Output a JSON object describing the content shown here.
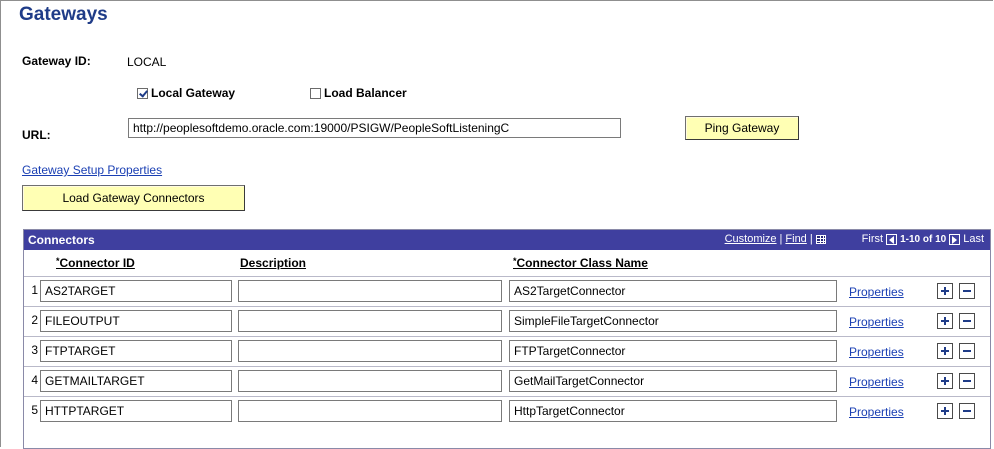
{
  "page": {
    "title": "Gateways"
  },
  "gateway": {
    "id_label": "Gateway ID:",
    "id_value": "LOCAL",
    "local_gateway_label": "Local Gateway",
    "local_gateway_checked": true,
    "load_balancer_label": "Load Balancer",
    "load_balancer_checked": false,
    "url_label": "URL:",
    "url_value": "http://peoplesoftdemo.oracle.com:19000/PSIGW/PeopleSoftListeningC",
    "ping_button": "Ping Gateway",
    "setup_link": "Gateway Setup Properties",
    "load_connectors_button": "Load Gateway Connectors"
  },
  "grid": {
    "title": "Connectors",
    "customize": "Customize",
    "find": "Find",
    "first": "First",
    "range": "1-10 of 10",
    "last": "Last",
    "columns": {
      "connector_id": "Connector ID",
      "description": "Description",
      "class_name": "Connector Class Name"
    },
    "properties_label": "Properties",
    "rows": [
      {
        "num": "1",
        "connector_id": "AS2TARGET",
        "description": "",
        "class_name": "AS2TargetConnector"
      },
      {
        "num": "2",
        "connector_id": "FILEOUTPUT",
        "description": "",
        "class_name": "SimpleFileTargetConnector"
      },
      {
        "num": "3",
        "connector_id": "FTPTARGET",
        "description": "",
        "class_name": "FTPTargetConnector"
      },
      {
        "num": "4",
        "connector_id": "GETMAILTARGET",
        "description": "",
        "class_name": "GetMailTargetConnector"
      },
      {
        "num": "5",
        "connector_id": "HTTPTARGET",
        "description": "",
        "class_name": "HttpTargetConnector"
      }
    ]
  }
}
